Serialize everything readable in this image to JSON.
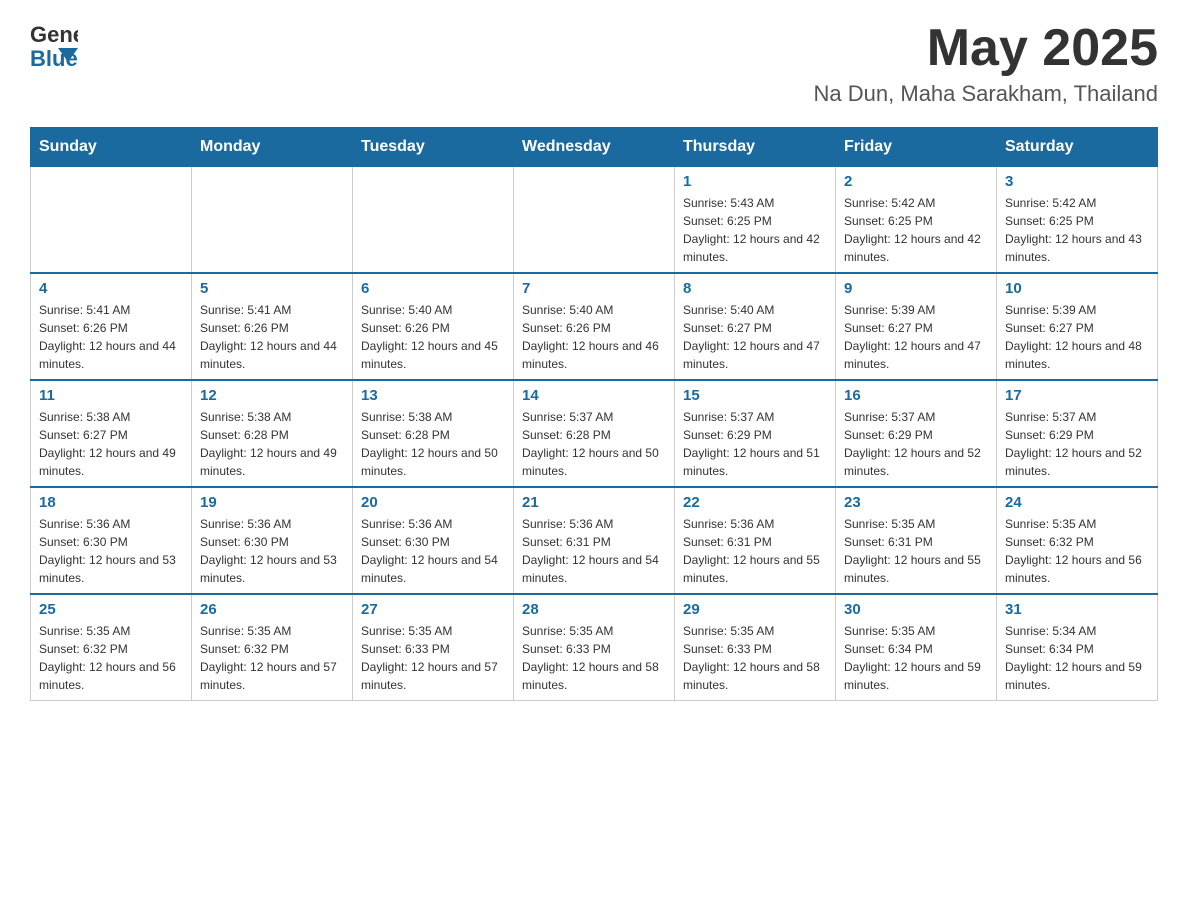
{
  "header": {
    "logo_general": "General",
    "logo_blue": "Blue",
    "month_year": "May 2025",
    "location": "Na Dun, Maha Sarakham, Thailand"
  },
  "weekdays": [
    "Sunday",
    "Monday",
    "Tuesday",
    "Wednesday",
    "Thursday",
    "Friday",
    "Saturday"
  ],
  "weeks": [
    [
      {
        "day": "",
        "sunrise": "",
        "sunset": "",
        "daylight": ""
      },
      {
        "day": "",
        "sunrise": "",
        "sunset": "",
        "daylight": ""
      },
      {
        "day": "",
        "sunrise": "",
        "sunset": "",
        "daylight": ""
      },
      {
        "day": "",
        "sunrise": "",
        "sunset": "",
        "daylight": ""
      },
      {
        "day": "1",
        "sunrise": "Sunrise: 5:43 AM",
        "sunset": "Sunset: 6:25 PM",
        "daylight": "Daylight: 12 hours and 42 minutes."
      },
      {
        "day": "2",
        "sunrise": "Sunrise: 5:42 AM",
        "sunset": "Sunset: 6:25 PM",
        "daylight": "Daylight: 12 hours and 42 minutes."
      },
      {
        "day": "3",
        "sunrise": "Sunrise: 5:42 AM",
        "sunset": "Sunset: 6:25 PM",
        "daylight": "Daylight: 12 hours and 43 minutes."
      }
    ],
    [
      {
        "day": "4",
        "sunrise": "Sunrise: 5:41 AM",
        "sunset": "Sunset: 6:26 PM",
        "daylight": "Daylight: 12 hours and 44 minutes."
      },
      {
        "day": "5",
        "sunrise": "Sunrise: 5:41 AM",
        "sunset": "Sunset: 6:26 PM",
        "daylight": "Daylight: 12 hours and 44 minutes."
      },
      {
        "day": "6",
        "sunrise": "Sunrise: 5:40 AM",
        "sunset": "Sunset: 6:26 PM",
        "daylight": "Daylight: 12 hours and 45 minutes."
      },
      {
        "day": "7",
        "sunrise": "Sunrise: 5:40 AM",
        "sunset": "Sunset: 6:26 PM",
        "daylight": "Daylight: 12 hours and 46 minutes."
      },
      {
        "day": "8",
        "sunrise": "Sunrise: 5:40 AM",
        "sunset": "Sunset: 6:27 PM",
        "daylight": "Daylight: 12 hours and 47 minutes."
      },
      {
        "day": "9",
        "sunrise": "Sunrise: 5:39 AM",
        "sunset": "Sunset: 6:27 PM",
        "daylight": "Daylight: 12 hours and 47 minutes."
      },
      {
        "day": "10",
        "sunrise": "Sunrise: 5:39 AM",
        "sunset": "Sunset: 6:27 PM",
        "daylight": "Daylight: 12 hours and 48 minutes."
      }
    ],
    [
      {
        "day": "11",
        "sunrise": "Sunrise: 5:38 AM",
        "sunset": "Sunset: 6:27 PM",
        "daylight": "Daylight: 12 hours and 49 minutes."
      },
      {
        "day": "12",
        "sunrise": "Sunrise: 5:38 AM",
        "sunset": "Sunset: 6:28 PM",
        "daylight": "Daylight: 12 hours and 49 minutes."
      },
      {
        "day": "13",
        "sunrise": "Sunrise: 5:38 AM",
        "sunset": "Sunset: 6:28 PM",
        "daylight": "Daylight: 12 hours and 50 minutes."
      },
      {
        "day": "14",
        "sunrise": "Sunrise: 5:37 AM",
        "sunset": "Sunset: 6:28 PM",
        "daylight": "Daylight: 12 hours and 50 minutes."
      },
      {
        "day": "15",
        "sunrise": "Sunrise: 5:37 AM",
        "sunset": "Sunset: 6:29 PM",
        "daylight": "Daylight: 12 hours and 51 minutes."
      },
      {
        "day": "16",
        "sunrise": "Sunrise: 5:37 AM",
        "sunset": "Sunset: 6:29 PM",
        "daylight": "Daylight: 12 hours and 52 minutes."
      },
      {
        "day": "17",
        "sunrise": "Sunrise: 5:37 AM",
        "sunset": "Sunset: 6:29 PM",
        "daylight": "Daylight: 12 hours and 52 minutes."
      }
    ],
    [
      {
        "day": "18",
        "sunrise": "Sunrise: 5:36 AM",
        "sunset": "Sunset: 6:30 PM",
        "daylight": "Daylight: 12 hours and 53 minutes."
      },
      {
        "day": "19",
        "sunrise": "Sunrise: 5:36 AM",
        "sunset": "Sunset: 6:30 PM",
        "daylight": "Daylight: 12 hours and 53 minutes."
      },
      {
        "day": "20",
        "sunrise": "Sunrise: 5:36 AM",
        "sunset": "Sunset: 6:30 PM",
        "daylight": "Daylight: 12 hours and 54 minutes."
      },
      {
        "day": "21",
        "sunrise": "Sunrise: 5:36 AM",
        "sunset": "Sunset: 6:31 PM",
        "daylight": "Daylight: 12 hours and 54 minutes."
      },
      {
        "day": "22",
        "sunrise": "Sunrise: 5:36 AM",
        "sunset": "Sunset: 6:31 PM",
        "daylight": "Daylight: 12 hours and 55 minutes."
      },
      {
        "day": "23",
        "sunrise": "Sunrise: 5:35 AM",
        "sunset": "Sunset: 6:31 PM",
        "daylight": "Daylight: 12 hours and 55 minutes."
      },
      {
        "day": "24",
        "sunrise": "Sunrise: 5:35 AM",
        "sunset": "Sunset: 6:32 PM",
        "daylight": "Daylight: 12 hours and 56 minutes."
      }
    ],
    [
      {
        "day": "25",
        "sunrise": "Sunrise: 5:35 AM",
        "sunset": "Sunset: 6:32 PM",
        "daylight": "Daylight: 12 hours and 56 minutes."
      },
      {
        "day": "26",
        "sunrise": "Sunrise: 5:35 AM",
        "sunset": "Sunset: 6:32 PM",
        "daylight": "Daylight: 12 hours and 57 minutes."
      },
      {
        "day": "27",
        "sunrise": "Sunrise: 5:35 AM",
        "sunset": "Sunset: 6:33 PM",
        "daylight": "Daylight: 12 hours and 57 minutes."
      },
      {
        "day": "28",
        "sunrise": "Sunrise: 5:35 AM",
        "sunset": "Sunset: 6:33 PM",
        "daylight": "Daylight: 12 hours and 58 minutes."
      },
      {
        "day": "29",
        "sunrise": "Sunrise: 5:35 AM",
        "sunset": "Sunset: 6:33 PM",
        "daylight": "Daylight: 12 hours and 58 minutes."
      },
      {
        "day": "30",
        "sunrise": "Sunrise: 5:35 AM",
        "sunset": "Sunset: 6:34 PM",
        "daylight": "Daylight: 12 hours and 59 minutes."
      },
      {
        "day": "31",
        "sunrise": "Sunrise: 5:34 AM",
        "sunset": "Sunset: 6:34 PM",
        "daylight": "Daylight: 12 hours and 59 minutes."
      }
    ]
  ]
}
